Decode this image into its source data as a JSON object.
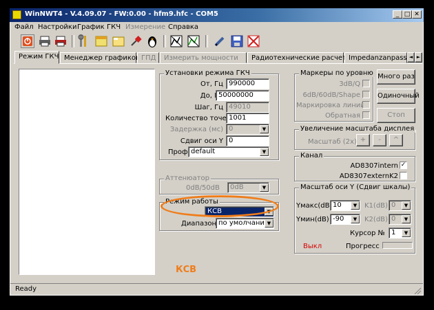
{
  "window": {
    "title": "WinNWT4 - V.4.09.07 - FW:0.00 - hfm9.hfc - COM5",
    "min": "_",
    "max": "□",
    "close": "✕"
  },
  "menu": [
    {
      "label": "Файл",
      "enabled": true
    },
    {
      "label": "Настройки",
      "enabled": true
    },
    {
      "label": "График",
      "enabled": true
    },
    {
      "label": "ГКЧ",
      "enabled": true
    },
    {
      "label": "Измерение",
      "enabled": false
    },
    {
      "label": "Справка",
      "enabled": true
    }
  ],
  "toolbar": [
    "power-icon",
    "print-icon",
    "print-color-icon",
    "tools-icon",
    "window-icon",
    "folder-icon",
    "pin-icon",
    "penguin-icon",
    "chart-icon",
    "chart-green-icon",
    "pen-icon",
    "save-icon",
    "clear-icon"
  ],
  "tabs": [
    {
      "label": "Режим ГКЧ",
      "active": true,
      "enabled": true
    },
    {
      "label": "Менеджер графиков",
      "enabled": true
    },
    {
      "label": "ГПД",
      "enabled": false
    },
    {
      "label": "Измерить мощности",
      "enabled": false
    },
    {
      "label": "Радиотехнические расчеты",
      "enabled": true
    },
    {
      "label": "Impedanzanpass",
      "enabled": true
    }
  ],
  "tab_scroll": {
    "left": "◄",
    "right": "►"
  },
  "gkch": {
    "title": "Установки режима ГКЧ",
    "from_label": "От, Гц",
    "from_value": "990000",
    "to_label": "До, Гц",
    "to_value": "50000000",
    "step_label": "Шаг, Гц",
    "step_value": "49010",
    "points_label": "Количество точек",
    "points_value": "1001",
    "delay_label": "Задержка (мс)",
    "delay_value": "0",
    "shift_label": "Сдвиг оси Y",
    "shift_value": "0",
    "profile_label": "Проф",
    "profile_value": "default"
  },
  "attenuator": {
    "title": "Аттенюатор",
    "label": "0dB/50dB",
    "value": "0dB"
  },
  "mode": {
    "title": "Режим работы",
    "value": "КСВ",
    "range_label": "Диапазон",
    "range_value": "по умолчанию"
  },
  "annotation": "КСВ",
  "markers": {
    "title": "Маркеры по уровню",
    "items": [
      "3dB/Q",
      "6dB/60dB/Shape",
      "Маркировка линий",
      "Обратная"
    ]
  },
  "buttons": {
    "many": "Много раз",
    "single": "Одиночный",
    "stop": "Стоп"
  },
  "zoom": {
    "title": "Увеличение масштаба дисплея",
    "label": "Масштаб (2x)",
    "plus": "+",
    "minus": "-",
    "caret": "^"
  },
  "channel": {
    "title": "Канал",
    "internal_label": "AD8307intern",
    "internal_checked": true,
    "external_label": "AD8307externK2",
    "external_checked": false
  },
  "yscale": {
    "title": "Масштаб оси Y (Сдвиг шкалы)",
    "ymax_label": "Yмакс(dB",
    "ymax_value": "10",
    "ymin_label": "Yмин(dB)",
    "ymin_value": "-90",
    "k1_label": "K1(dB)",
    "k1_value": "0",
    "k2_label": "K2(dB)",
    "k2_value": "0",
    "cursor_label": "Курсор №",
    "cursor_value": "1",
    "off_label": "Выкл",
    "progress_label": "Прогресс"
  },
  "status": {
    "text": "Ready"
  },
  "colors": {
    "highlight_ring": "#ef7d1a",
    "annotation": "#ef7d1a",
    "selection": "#0a246a",
    "off_text": "#d40000"
  }
}
